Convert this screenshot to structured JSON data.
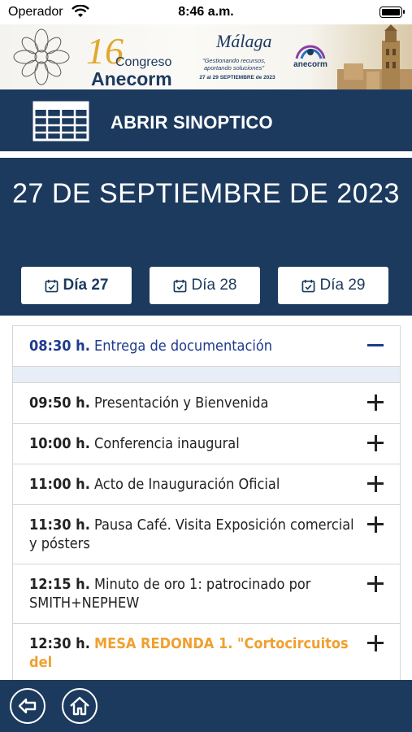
{
  "status_bar": {
    "carrier": "Operador",
    "time": "8:46 a.m.",
    "battery_level": 1.0
  },
  "banner": {
    "edition": "16",
    "congreso": "Congreso",
    "name": "Anecorm",
    "city": "Málaga",
    "slogan": "\"Gestionando recursos, aportando soluciones\"",
    "dates": "27 al 29 SEPTIEMBRE de 2023",
    "logo_text": "anecorm"
  },
  "synoptic": {
    "label": "ABRIR SINOPTICO"
  },
  "date_header": {
    "title": "27 DE SEPTIEMBRE DE 2023"
  },
  "day_tabs": [
    {
      "label": "Día 27",
      "active": true
    },
    {
      "label": "Día 28",
      "active": false
    },
    {
      "label": "Día 29",
      "active": false
    }
  ],
  "agenda": [
    {
      "time": "08:30 h.",
      "title": "Entrega de documentación",
      "expanded": true
    },
    {
      "time": "09:50 h.",
      "title": "Presentación y Bienvenida"
    },
    {
      "time": "10:00 h.",
      "title": "Conferencia inaugural"
    },
    {
      "time": "11:00 h.",
      "title": "Acto de Inauguración Oficial"
    },
    {
      "time": "11:30 h.",
      "title": "Pausa Café. Visita Exposición comercial y pósters"
    },
    {
      "time": "12:15 h.",
      "title": "Minuto de oro 1: patrocinado por SMITH+NEPHEW"
    },
    {
      "time": "12:30 h.",
      "title": "MESA REDONDA 1. \"Cortocircuitos del",
      "highlight": true
    }
  ],
  "colors": {
    "primary": "#1c3a5e",
    "accent_blue": "#1f3a8f",
    "highlight_orange": "#f0a030"
  },
  "icons": {
    "back": "back-arrow-icon",
    "home": "home-icon",
    "calendar": "calendar-check-icon",
    "table": "table-icon"
  }
}
